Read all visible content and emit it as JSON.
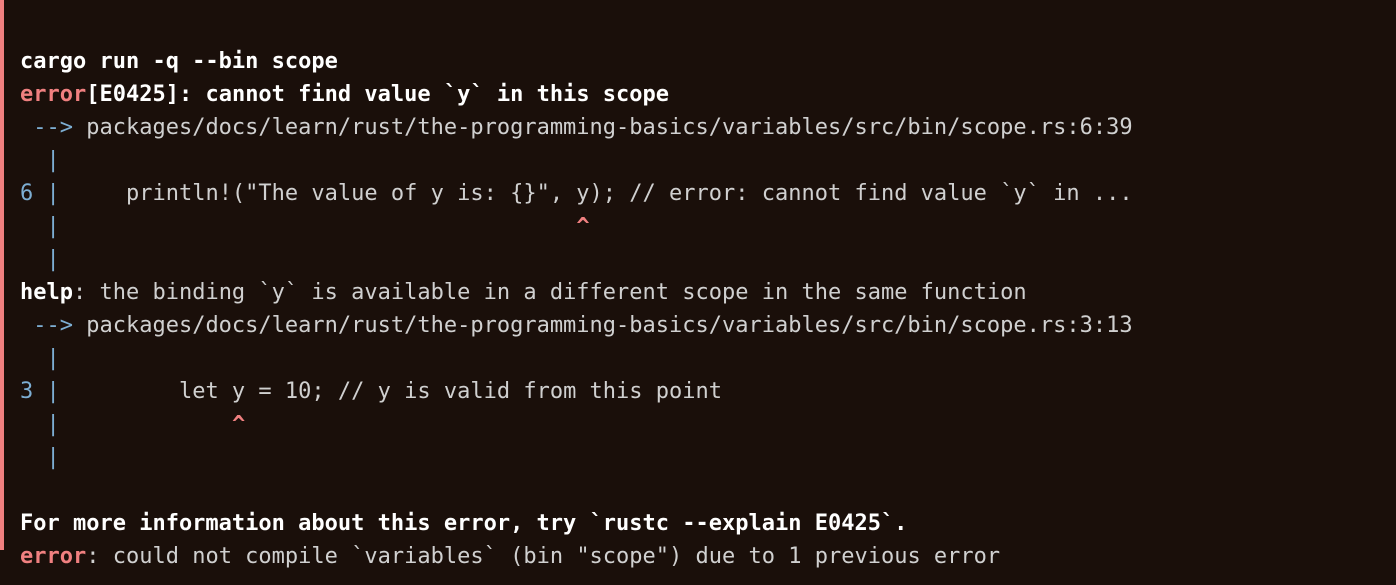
{
  "command": "cargo run -q --bin scope",
  "error": {
    "tag": "error",
    "code": "[E0425]",
    "colon": ": ",
    "message": "cannot find value `y` in this scope"
  },
  "loc1": {
    "arrow": " --> ",
    "path": "packages/docs/learn/rust/the-programming-basics/variables/src/bin/scope.rs:6:39"
  },
  "pipe_empty1": "  |",
  "line6": {
    "num": "6 ",
    "pipe": "|",
    "code": "     println!(\"The value of y is: {}\", y); // error: cannot find value `y` in ..."
  },
  "caret_line1": {
    "prefix": "  |",
    "spaces": "                                       ",
    "caret": "^"
  },
  "pipe_empty2": "  |",
  "help": {
    "tag": "help",
    "colon": ": ",
    "message": "the binding `y` is available in a different scope in the same function"
  },
  "loc2": {
    "arrow": " --> ",
    "path": "packages/docs/learn/rust/the-programming-basics/variables/src/bin/scope.rs:3:13"
  },
  "pipe_empty3": "  |",
  "line3": {
    "num": "3 ",
    "pipe": "|",
    "code": "         let y = 10; // y is valid from this point"
  },
  "caret_line2": {
    "prefix": "  |",
    "spaces": "             ",
    "caret": "^"
  },
  "pipe_empty4": "  |",
  "blank": "",
  "footer": "For more information about this error, try `rustc --explain E0425`.",
  "final": {
    "tag": "error",
    "colon": ": ",
    "message": "could not compile `variables` (bin \"scope\") due to 1 previous error"
  }
}
